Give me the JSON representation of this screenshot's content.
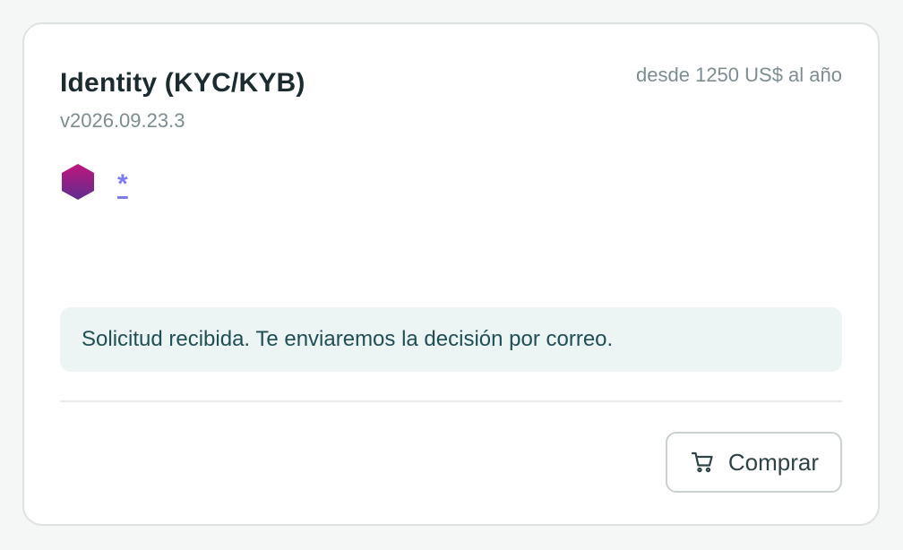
{
  "product": {
    "title": "Identity (KYC/KYB)",
    "price": "desde 1250 US$ al año",
    "version": "v2026.09.23.3",
    "tags": {
      "hex_icon": "hexagon-icon",
      "asterisk_link": "*"
    },
    "notice": "Solicitud recibida. Te enviaremos la decisión por correo.",
    "buy_button": {
      "label": "Comprar",
      "icon": "cart-icon"
    }
  },
  "colors": {
    "title": "#1b2b2f",
    "muted": "#7c8d91",
    "link": "#7b7cf0",
    "notice_bg": "#edf5f4",
    "notice_text": "#1f4e55",
    "hex_top": "#b5177f",
    "hex_bottom": "#6a2a8c"
  }
}
